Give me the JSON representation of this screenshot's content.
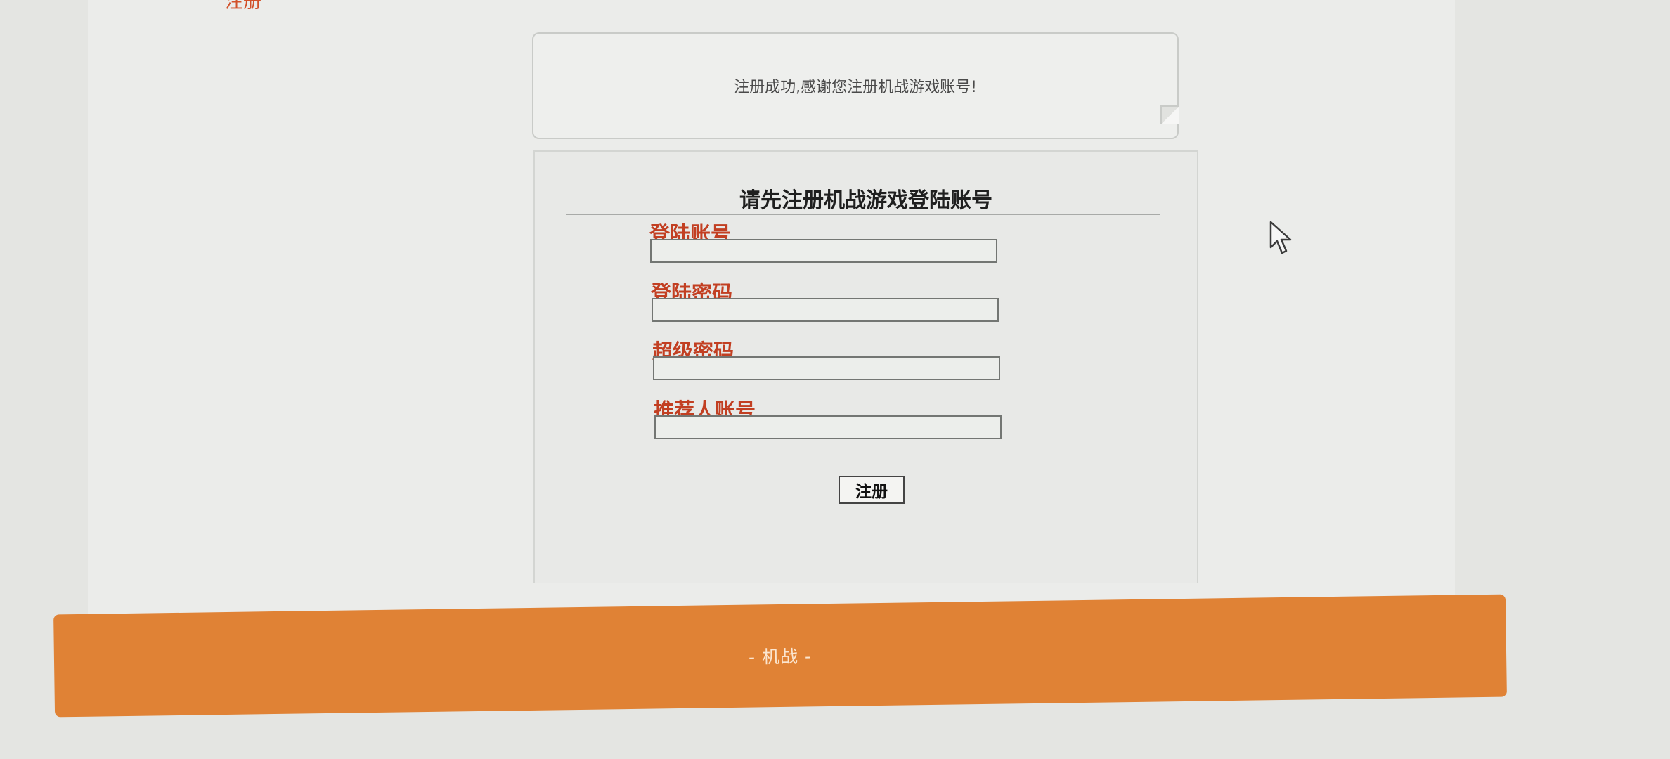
{
  "header": {
    "top_link": "注册"
  },
  "notice": {
    "message": "注册成功,感谢您注册机战游戏账号!"
  },
  "form": {
    "title": "请先注册机战游戏登陆账号",
    "fields": [
      {
        "label": "登陆账号",
        "value": "",
        "placeholder": ""
      },
      {
        "label": "登陆密码",
        "value": "",
        "placeholder": ""
      },
      {
        "label": "超级密码",
        "value": "",
        "placeholder": ""
      },
      {
        "label": "推荐人账号",
        "value": "",
        "placeholder": ""
      }
    ],
    "submit_label": "注册"
  },
  "footer": {
    "text": "- 机战 -"
  },
  "icons": {
    "cursor": "mouse-pointer-icon"
  },
  "colors": {
    "label_red": "#c23f22",
    "footer_orange": "#e08235",
    "background": "#ebecea"
  }
}
